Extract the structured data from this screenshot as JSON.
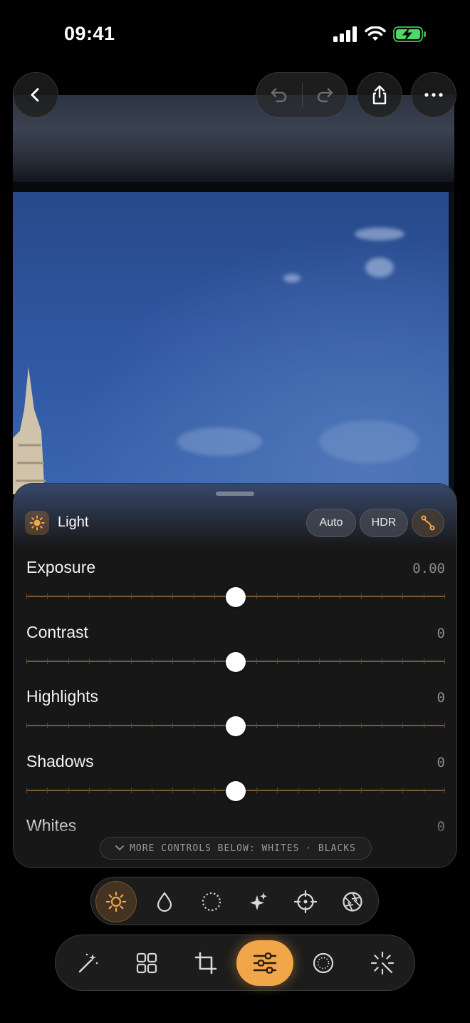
{
  "status": {
    "time": "09:41"
  },
  "panel": {
    "title": "Light",
    "auto_label": "Auto",
    "hdr_label": "HDR",
    "sliders": [
      {
        "label": "Exposure",
        "value": "0.00",
        "level": 0.5
      },
      {
        "label": "Contrast",
        "value": "0",
        "level": 0.5
      },
      {
        "label": "Highlights",
        "value": "0",
        "level": 0.5
      },
      {
        "label": "Shadows",
        "value": "0",
        "level": 0.5
      },
      {
        "label": "Whites",
        "value": "0",
        "level": 0.5
      }
    ],
    "more_hint": "MORE CONTROLS BELOW: WHITES · BLACKS"
  },
  "colors": {
    "accent": "#f2a64a",
    "track": "#7a5a34"
  },
  "icons": {
    "top": [
      "back-icon",
      "undo-icon",
      "redo-icon",
      "share-icon",
      "more-icon"
    ],
    "subbar": [
      "sun-icon",
      "drop-icon",
      "dotted-circle-icon",
      "sparkle-icon",
      "crosshair-icon",
      "aperture-icon"
    ],
    "mainbar": [
      "magic-wand-icon",
      "grid-icon",
      "crop-icon",
      "sliders-icon",
      "vignette-icon",
      "auto-enhance-icon"
    ]
  },
  "active": {
    "subbar": "sun-icon",
    "mainbar": "sliders-icon"
  }
}
